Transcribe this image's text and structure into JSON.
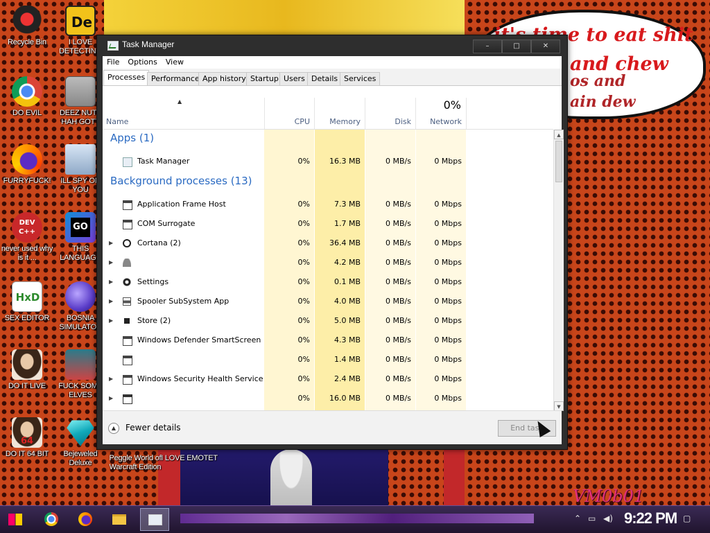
{
  "desktop": {
    "icons": [
      {
        "label": "Recycle Bin"
      },
      {
        "label": "I LOVE DETECTING"
      },
      {
        "label": "DO EVIL"
      },
      {
        "label": "DEEZ NUTZ HAH GOTT"
      },
      {
        "label": "FURRYFUCK!"
      },
      {
        "label": "ILL SPY ON YOU"
      },
      {
        "label": "never used why is it ..."
      },
      {
        "label": "THIS LANGUAGE"
      },
      {
        "label": "SEX EDITOR"
      },
      {
        "label": "BOSNIA SIMULATOR"
      },
      {
        "label": "DO IT LIVE"
      },
      {
        "label": "FUCK SOME ELVES"
      },
      {
        "label": "DO IT 64 BIT"
      },
      {
        "label": "Bejeweled Deluxe"
      }
    ],
    "misc_labels": {
      "peggle_label": "Peggle World of Warcraft Edition",
      "emotet_label": "I LOVE EMOTET"
    },
    "icon_glyphs": {
      "i_love_detecting": "De",
      "devcpp": "DEV C++",
      "go": "GO",
      "hxd": "HxD",
      "do_it_64": "64"
    }
  },
  "wallpaper": {
    "speech_lines": [
      "it's time to eat shit",
      "and chew",
      "os and",
      "ain dew"
    ],
    "vm_tag": "VM0b01"
  },
  "window": {
    "title": "Task Manager",
    "controls": {
      "minimize": "–",
      "maximize": "□",
      "close": "✕"
    },
    "menu": [
      "File",
      "Options",
      "View"
    ],
    "tabs": [
      "Processes",
      "Performance",
      "App history",
      "Startup",
      "Users",
      "Details",
      "Services"
    ],
    "active_tab": "Processes"
  },
  "table": {
    "columns": {
      "name": "Name",
      "cpu": "CPU",
      "memory": "Memory",
      "disk": "Disk",
      "network": "Network",
      "network_pct": "0%"
    },
    "groups": [
      {
        "title": "Apps (1)",
        "rows": [
          {
            "name": "Task Manager",
            "icon": "taskmgr-icon",
            "expandable": false,
            "cpu": "0%",
            "memory": "16.3 MB",
            "disk": "0 MB/s",
            "network": "0 Mbps"
          }
        ]
      },
      {
        "title": "Background processes (13)",
        "rows": [
          {
            "name": "Application Frame Host",
            "icon": "app-window-icon",
            "expandable": false,
            "cpu": "0%",
            "memory": "7.3 MB",
            "disk": "0 MB/s",
            "network": "0 Mbps"
          },
          {
            "name": "COM Surrogate",
            "icon": "app-window-icon",
            "expandable": false,
            "cpu": "0%",
            "memory": "1.7 MB",
            "disk": "0 MB/s",
            "network": "0 Mbps"
          },
          {
            "name": "Cortana (2)",
            "icon": "cortana-icon",
            "expandable": true,
            "cpu": "0%",
            "memory": "36.4 MB",
            "disk": "0 MB/s",
            "network": "0 Mbps"
          },
          {
            "name": "",
            "icon": "user-icon",
            "expandable": true,
            "cpu": "0%",
            "memory": "4.2 MB",
            "disk": "0 MB/s",
            "network": "0 Mbps"
          },
          {
            "name": "Settings",
            "icon": "settings-gear-icon",
            "expandable": true,
            "cpu": "0%",
            "memory": "0.1 MB",
            "disk": "0 MB/s",
            "network": "0 Mbps"
          },
          {
            "name": "Spooler SubSystem App",
            "icon": "printer-icon",
            "expandable": true,
            "cpu": "0%",
            "memory": "4.0 MB",
            "disk": "0 MB/s",
            "network": "0 Mbps"
          },
          {
            "name": "Store (2)",
            "icon": "store-icon",
            "expandable": true,
            "cpu": "0%",
            "memory": "5.0 MB",
            "disk": "0 MB/s",
            "network": "0 Mbps"
          },
          {
            "name": "Windows Defender SmartScreen",
            "icon": "app-window-icon",
            "expandable": false,
            "cpu": "0%",
            "memory": "4.3 MB",
            "disk": "0 MB/s",
            "network": "0 Mbps"
          },
          {
            "name": "",
            "icon": "app-window-icon",
            "expandable": false,
            "cpu": "0%",
            "memory": "1.4 MB",
            "disk": "0 MB/s",
            "network": "0 Mbps"
          },
          {
            "name": "Windows Security Health Service",
            "icon": "app-window-icon",
            "expandable": true,
            "cpu": "0%",
            "memory": "2.4 MB",
            "disk": "0 MB/s",
            "network": "0 Mbps"
          },
          {
            "name": "",
            "icon": "service-host-icon",
            "expandable": true,
            "cpu": "0%",
            "memory": "16.0 MB",
            "disk": "0 MB/s",
            "network": "0 Mbps"
          }
        ]
      }
    ]
  },
  "footer": {
    "fewer_details": "Fewer details",
    "end_task": "End task"
  },
  "taskbar": {
    "clock": "9:22 PM",
    "pinned": [
      "start-icon",
      "chrome-icon",
      "firefox-icon",
      "explorer-icon",
      "taskmgr-icon"
    ]
  },
  "colors": {
    "group_title": "#2a6ac2",
    "memory_highlight": "#fdeea8",
    "cpu_highlight": "#fff6d2",
    "column_highlight": "#fff9e2"
  }
}
